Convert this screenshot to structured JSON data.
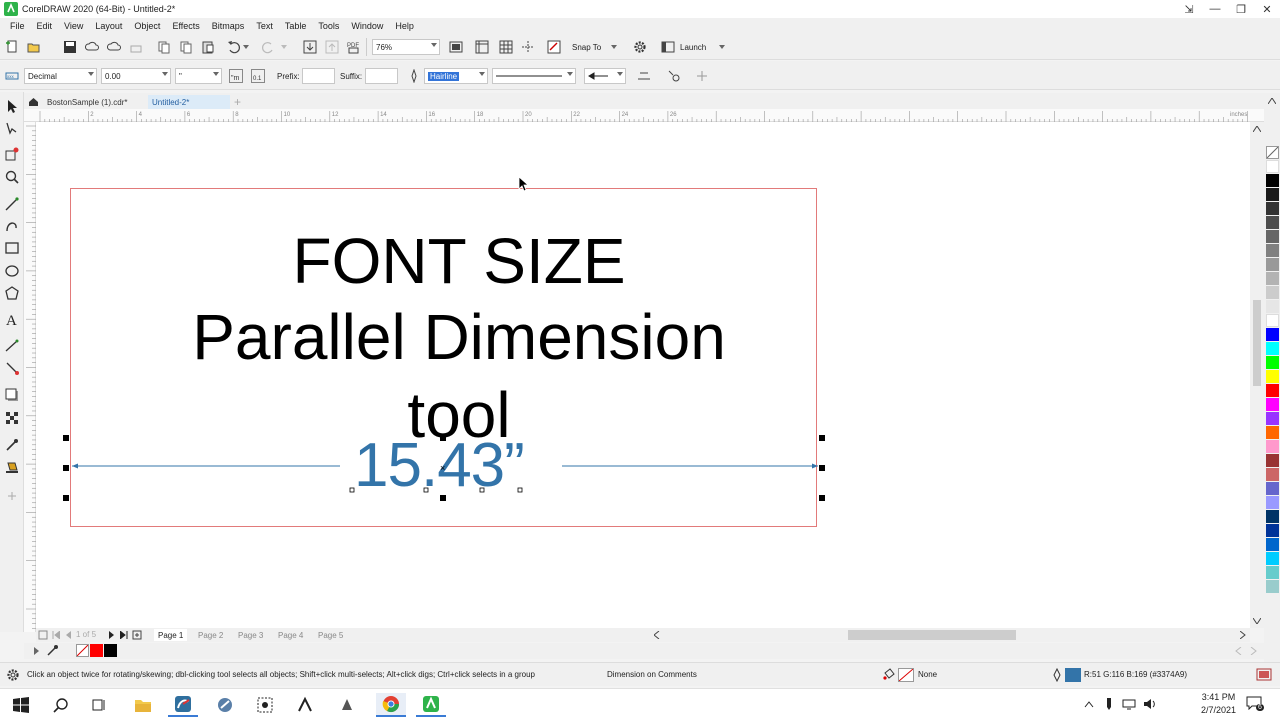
{
  "window": {
    "title": "CorelDRAW 2020 (64-Bit) - Untitled-2*"
  },
  "menu": [
    "File",
    "Edit",
    "View",
    "Layout",
    "Object",
    "Effects",
    "Bitmaps",
    "Text",
    "Table",
    "Tools",
    "Window",
    "Help"
  ],
  "toolbar": {
    "zoom": "76%",
    "snap_to": "Snap To",
    "launch": "Launch"
  },
  "propbar": {
    "units_style": "Decimal",
    "precision": "0.00",
    "units": "\"",
    "prefix_label": "Prefix:",
    "prefix_value": "",
    "suffix_label": "Suffix:",
    "suffix_value": "",
    "outline_width": "Hairline"
  },
  "tabs": [
    {
      "label": "BostonSample (1).cdr*",
      "active": false
    },
    {
      "label": "Untitled-2*",
      "active": true
    }
  ],
  "ruler": {
    "top_ticks": [
      "2",
      "4",
      "6",
      "8",
      "10",
      "12",
      "14",
      "16",
      "18",
      "20",
      "22",
      "24",
      "26"
    ],
    "unit": "inches"
  },
  "canvas": {
    "line1": "FONT SIZE",
    "line2": "Parallel Dimension",
    "line3": "tool",
    "dimension_value": "15.43”"
  },
  "pages": {
    "current": "Page 1",
    "others": [
      "Page 2",
      "Page 3",
      "Page 4",
      "Page 5"
    ],
    "counter": "1 of 5"
  },
  "status": {
    "hint": "Click an object twice for rotating/skewing; dbl-clicking tool selects all objects; Shift+click multi-selects; Alt+click digs; Ctrl+click selects in a group",
    "object_info": "Dimension on Comments",
    "fill": "None",
    "outline_color": "R:51 G:116 B:169 (#3374A9)",
    "outline_hex": "#3374A9"
  },
  "taskbar": {
    "time": "3:41 PM",
    "date": "2/7/2021",
    "notifications": "6"
  },
  "palette_colors": [
    "#ffffff",
    "#000000",
    "#1a1a1a",
    "#333333",
    "#4d4d4d",
    "#666666",
    "#808080",
    "#999999",
    "#b3b3b3",
    "#cccccc",
    "#e6e6e6",
    "#ffffff",
    "#0000ff",
    "#00ffff",
    "#00ff00",
    "#ffff00",
    "#ff0000",
    "#ff00ff",
    "#9933ff",
    "#ff6600",
    "#ff99cc",
    "#993333",
    "#cc6666",
    "#6666cc",
    "#9999ff",
    "#003366",
    "#003399",
    "#0066cc",
    "#00ccff",
    "#66cccc",
    "#99cccc"
  ]
}
